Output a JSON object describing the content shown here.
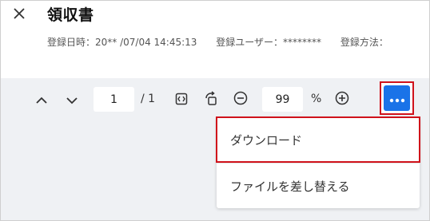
{
  "header": {
    "title": "領収書",
    "close_icon": "close-icon",
    "meta": {
      "registered_at_label": "登録日時：",
      "registered_at_value": "20** /07/04 14:45:13",
      "registered_user_label": "登録ユーザー：",
      "registered_user_value": "********",
      "registration_method_label": "登録方法："
    }
  },
  "toolbar": {
    "prev_icon": "chevron-up-icon",
    "next_icon": "chevron-down-icon",
    "page_current": "1",
    "page_separator_total": "/ 1",
    "fit_icon": "fit-width-icon",
    "rotate_icon": "rotate-icon",
    "zoom_out_icon": "zoom-out-icon",
    "zoom_value": "99",
    "zoom_unit": "%",
    "zoom_in_icon": "zoom-in-icon",
    "more_icon": "more-horizontal-icon"
  },
  "menu": {
    "items": [
      {
        "label": "ダウンロード",
        "highlighted": true
      },
      {
        "label": "ファイルを差し替える",
        "highlighted": false
      }
    ]
  },
  "colors": {
    "accent": "#1a73e8",
    "highlight_border": "#d0121b",
    "toolbar_bg": "#eff1f4"
  }
}
